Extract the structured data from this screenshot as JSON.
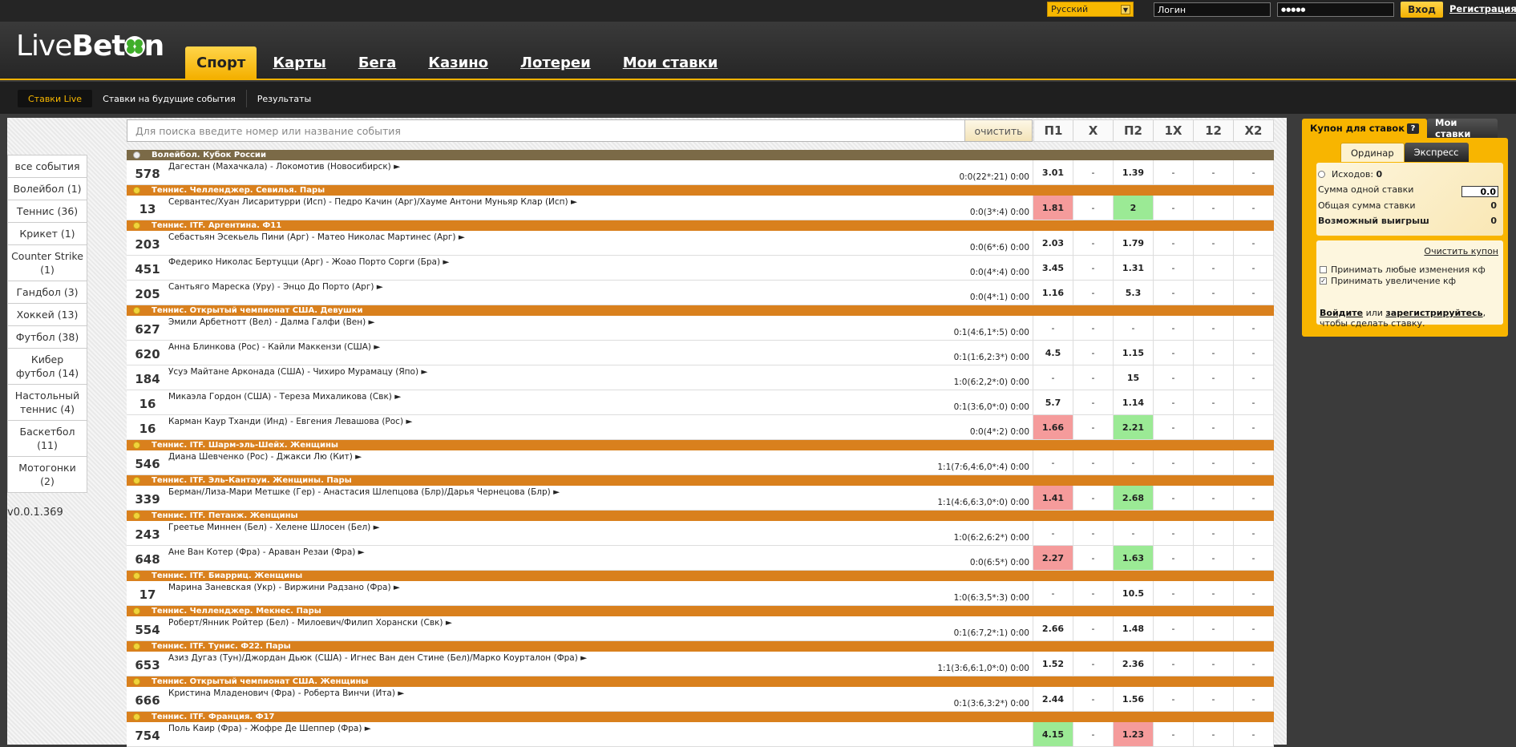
{
  "topbar": {
    "language": "Русский",
    "login_placeholder": "Логин",
    "password_value": "●●●●●",
    "login_button": "Вход",
    "register_link": "Регистрация"
  },
  "logo": {
    "part1": "Live",
    "part2": "Bet",
    "part3": "n"
  },
  "main_nav": [
    {
      "label": "Спорт",
      "active": true
    },
    {
      "label": "Карты"
    },
    {
      "label": "Бега"
    },
    {
      "label": "Казино"
    },
    {
      "label": "Лотереи"
    },
    {
      "label": "Мои ставки"
    }
  ],
  "sub_nav": [
    {
      "label": "Ставки Live",
      "active": true
    },
    {
      "label": "Ставки на будущие события"
    },
    {
      "label": "Результаты"
    }
  ],
  "sidebar": [
    "все события",
    "Волейбол (1)",
    "Теннис (36)",
    "Крикет (1)",
    "Counter Strike (1)",
    "Гандбол (3)",
    "Хоккей (13)",
    "Футбол (38)",
    "Кибер футбол (14)",
    "Настольный теннис (4)",
    "Баскетбол (11)",
    "Мотогонки (2)"
  ],
  "version": "v0.0.1.369",
  "search": {
    "placeholder": "Для поиска введите номер или название события",
    "clear_label": "очистить"
  },
  "columns": [
    "П1",
    "X",
    "П2",
    "1X",
    "12",
    "X2"
  ],
  "events": [
    {
      "league": "Волейбол. Кубок России",
      "league_style": "vb"
    },
    {
      "num": "578",
      "name": "Дагестан (Махачкала) - Локомотив (Новосибирск) ►",
      "score": "0:0(22*:21)   0:00",
      "odds": [
        "3.01",
        "-",
        "1.39",
        "-",
        "-",
        "-"
      ],
      "hl": [
        "",
        "",
        "",
        "",
        "",
        ""
      ]
    },
    {
      "league": "Теннис. Челленджер. Севилья. Пары"
    },
    {
      "num": "13",
      "name": "Сервантес/Хуан Лисаритурри (Исп) - Педро Качин (Арг)/Хауме Антони Муньяр Клар (Исп) ►",
      "score": "0:0(3*:4)   0:00",
      "odds": [
        "1.81",
        "-",
        "2",
        "-",
        "-",
        "-"
      ],
      "hl": [
        "red",
        "",
        "green",
        "",
        "",
        ""
      ]
    },
    {
      "league": "Теннис. ITF. Аргентина. Ф11"
    },
    {
      "num": "203",
      "name": "Себастьян Эсекьель Пини (Арг) - Матео Николас Мартинес (Арг) ►",
      "score": "0:0(6*:6)   0:00",
      "odds": [
        "2.03",
        "-",
        "1.79",
        "-",
        "-",
        "-"
      ],
      "hl": [
        "",
        "",
        "",
        "",
        "",
        ""
      ]
    },
    {
      "num": "451",
      "name": "Федерико Николас Бертуцци (Арг) - Жоао Порто Сорги (Бра) ►",
      "score": "0:0(4*:4)   0:00",
      "odds": [
        "3.45",
        "-",
        "1.31",
        "-",
        "-",
        "-"
      ],
      "hl": [
        "",
        "",
        "",
        "",
        "",
        ""
      ]
    },
    {
      "num": "205",
      "name": "Сантьяго Мареска (Уру) - Энцо До Порто (Арг) ►",
      "score": "0:0(4*:1)   0:00",
      "odds": [
        "1.16",
        "-",
        "5.3",
        "-",
        "-",
        "-"
      ],
      "hl": [
        "",
        "",
        "",
        "",
        "",
        ""
      ]
    },
    {
      "league": "Теннис. Открытый чемпионат США. Девушки"
    },
    {
      "num": "627",
      "name": "Эмили Арбетнотт (Вел) - Далма Галфи (Вен) ►",
      "score": "0:1(4:6,1*:5)   0:00",
      "odds": [
        "-",
        "-",
        "-",
        "-",
        "-",
        "-"
      ],
      "hl": [
        "",
        "",
        "",
        "",
        "",
        ""
      ]
    },
    {
      "num": "620",
      "name": "Анна Блинкова (Рос) - Кайли Маккензи (США) ►",
      "score": "0:1(1:6,2:3*)   0:00",
      "odds": [
        "4.5",
        "-",
        "1.15",
        "-",
        "-",
        "-"
      ],
      "hl": [
        "",
        "",
        "",
        "",
        "",
        ""
      ]
    },
    {
      "num": "184",
      "name": "Усуэ Майтане Арконада (США) - Чихиро Мурамацу (Япо) ►",
      "score": "1:0(6:2,2*:0)   0:00",
      "odds": [
        "-",
        "-",
        "15",
        "-",
        "-",
        "-"
      ],
      "hl": [
        "",
        "",
        "",
        "",
        "",
        ""
      ]
    },
    {
      "num": "16",
      "name": "Микаэла Гордон (США) - Тереза Михаликова (Свк) ►",
      "score": "0:1(3:6,0*:0)   0:00",
      "odds": [
        "5.7",
        "-",
        "1.14",
        "-",
        "-",
        "-"
      ],
      "hl": [
        "",
        "",
        "",
        "",
        "",
        ""
      ]
    },
    {
      "num": "16",
      "name": "Карман Каур Тханди (Инд) - Евгения Левашова (Рос) ►",
      "score": "0:0(4*:2)   0:00",
      "odds": [
        "1.66",
        "-",
        "2.21",
        "-",
        "-",
        "-"
      ],
      "hl": [
        "red",
        "",
        "green",
        "",
        "",
        ""
      ]
    },
    {
      "league": "Теннис. ITF. Шарм-эль-Шейх. Женщины"
    },
    {
      "num": "546",
      "name": "Диана Шевченко (Рос) - Джакси Лю (Кит) ►",
      "score": "1:1(7:6,4:6,0*:4)   0:00",
      "odds": [
        "-",
        "-",
        "-",
        "-",
        "-",
        "-"
      ],
      "hl": [
        "",
        "",
        "",
        "",
        "",
        ""
      ]
    },
    {
      "league": "Теннис. ITF. Эль-Кантауи. Женщины. Пары"
    },
    {
      "num": "339",
      "name": "Берман/Лиза-Мари Метшке (Гер) - Анастасия Шлепцова (Блр)/Дарья Чернецова (Блр) ►",
      "score": "1:1(4:6,6:3,0*:0)   0:00",
      "odds": [
        "1.41",
        "-",
        "2.68",
        "-",
        "-",
        "-"
      ],
      "hl": [
        "red",
        "",
        "green",
        "",
        "",
        ""
      ]
    },
    {
      "league": "Теннис. ITF. Петанж. Женщины"
    },
    {
      "num": "243",
      "name": "Греетье Миннен (Бел) - Хелене Шлосен (Бел) ►",
      "score": "1:0(6:2,6:2*)   0:00",
      "odds": [
        "-",
        "-",
        "-",
        "-",
        "-",
        "-"
      ],
      "hl": [
        "",
        "",
        "",
        "",
        "",
        ""
      ]
    },
    {
      "num": "648",
      "name": "Ане Ван Котер (Фра) - Араван Резаи (Фра) ►",
      "score": "0:0(6:5*)   0:00",
      "odds": [
        "2.27",
        "-",
        "1.63",
        "-",
        "-",
        "-"
      ],
      "hl": [
        "red",
        "",
        "green",
        "",
        "",
        ""
      ]
    },
    {
      "league": "Теннис. ITF. Биарриц. Женщины"
    },
    {
      "num": "17",
      "name": "Марина Заневская (Укр) - Виржини Радзано (Фра) ►",
      "score": "1:0(6:3,5*:3)   0:00",
      "odds": [
        "-",
        "-",
        "10.5",
        "-",
        "-",
        "-"
      ],
      "hl": [
        "",
        "",
        "",
        "",
        "",
        ""
      ]
    },
    {
      "league": "Теннис. Челленджер. Мекнес. Пары"
    },
    {
      "num": "554",
      "name": "Роберт/Янник Ройтер (Бел) - Милоевич/Филип Хорански (Свк) ►",
      "score": "0:1(6:7,2*:1)   0:00",
      "odds": [
        "2.66",
        "-",
        "1.48",
        "-",
        "-",
        "-"
      ],
      "hl": [
        "",
        "",
        "",
        "",
        "",
        ""
      ]
    },
    {
      "league": "Теннис. ITF. Тунис. Ф22. Пары"
    },
    {
      "num": "653",
      "name": "Азиз Дугаз (Тун)/Джордан Дьюк (США) - Игнес Ван ден Стине (Бел)/Марко Коурталон (Фра) ►",
      "score": "1:1(3:6,6:1,0*:0)   0:00",
      "odds": [
        "1.52",
        "-",
        "2.36",
        "-",
        "-",
        "-"
      ],
      "hl": [
        "",
        "",
        "",
        "",
        "",
        ""
      ]
    },
    {
      "league": "Теннис. Открытый чемпионат США. Женщины"
    },
    {
      "num": "666",
      "name": "Кристина Младенович (Фра) - Роберта Винчи (Ита) ►",
      "score": "0:1(3:6,3:2*)   0:00",
      "odds": [
        "2.44",
        "-",
        "1.56",
        "-",
        "-",
        "-"
      ],
      "hl": [
        "",
        "",
        "",
        "",
        "",
        ""
      ]
    },
    {
      "league": "Теннис. ITF. Франция. Ф17"
    },
    {
      "num": "754",
      "name": "Поль Каир (Фра) - Жофре Де Шеппер (Фра) ►",
      "score": "",
      "odds": [
        "4.15",
        "-",
        "1.23",
        "-",
        "-",
        "-"
      ],
      "hl": [
        "green",
        "",
        "red",
        "",
        "",
        ""
      ]
    }
  ],
  "coupon": {
    "tab_label": "Купон для ставок",
    "help": "?",
    "my_bets_tab": "Мои ставки",
    "types": [
      "Ординар",
      "Экспресс"
    ],
    "outcomes_label": "Исходов:",
    "outcomes_value": "0",
    "stake_label": "Сумма одной ставки",
    "stake_value": "0.0",
    "total_label": "Общая сумма ставки",
    "total_value": "0",
    "win_label": "Возможный выигрыш",
    "win_value": "0",
    "clear_label": "Очистить купон",
    "accept_any": "Принимать любые изменения кф",
    "accept_increase": "Принимать увеличение кф",
    "login_link": "Войдите",
    "or": " или ",
    "register_link": "зарегистрируйтесь",
    "suffix": ",",
    "suffix2": "чтобы сделать ставку."
  }
}
